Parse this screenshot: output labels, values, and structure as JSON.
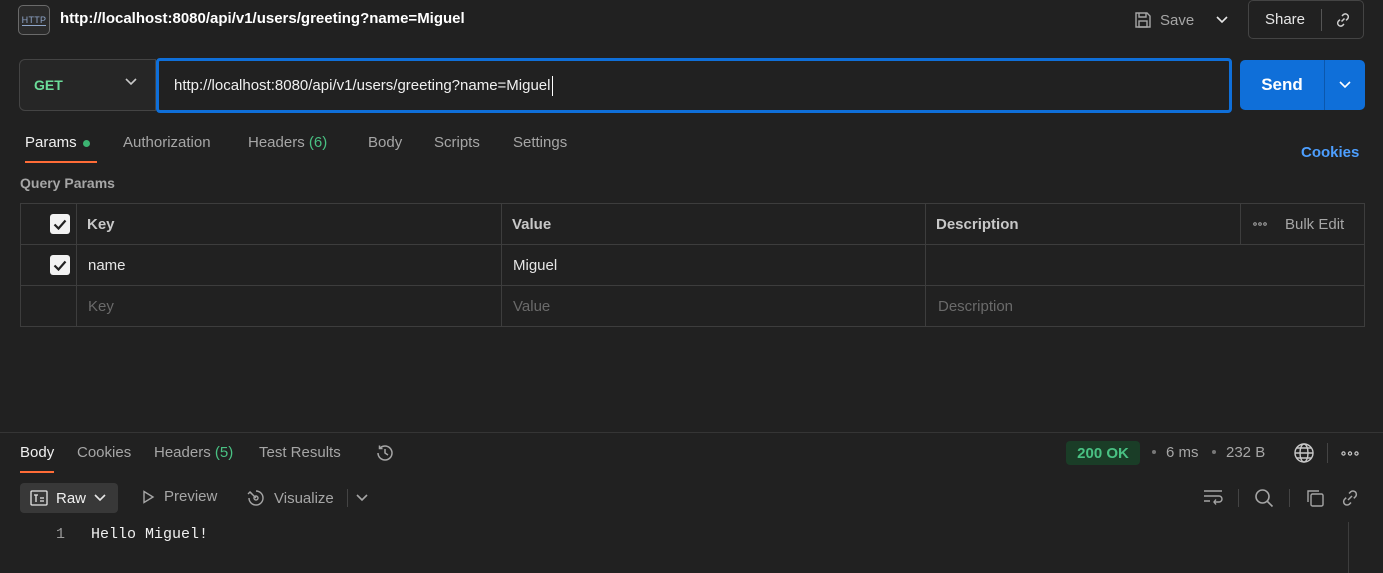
{
  "header": {
    "icon_label": "HTTP",
    "title": "http://localhost:8080/api/v1/users/greeting?name=Miguel",
    "save_label": "Save",
    "share_label": "Share"
  },
  "request": {
    "method": "GET",
    "url": "http://localhost:8080/api/v1/users/greeting?name=Miguel",
    "send_label": "Send"
  },
  "request_tabs": {
    "params": "Params",
    "authorization": "Authorization",
    "headers": "Headers",
    "headers_count": "(6)",
    "body": "Body",
    "scripts": "Scripts",
    "settings": "Settings",
    "cookies": "Cookies"
  },
  "query_params": {
    "label": "Query Params",
    "columns": [
      "Key",
      "Value",
      "Description"
    ],
    "bulk_edit": "Bulk Edit",
    "rows": [
      {
        "checked": true,
        "key": "name",
        "value": "Miguel",
        "description": ""
      }
    ],
    "placeholders": {
      "key": "Key",
      "value": "Value",
      "description": "Description"
    }
  },
  "response_tabs": {
    "body": "Body",
    "cookies": "Cookies",
    "headers": "Headers",
    "headers_count": "(5)",
    "test_results": "Test Results"
  },
  "response_meta": {
    "status": "200 OK",
    "time": "6 ms",
    "size": "232 B"
  },
  "response_toolbar": {
    "format": "Raw",
    "preview": "Preview",
    "visualize": "Visualize"
  },
  "response_body": {
    "line_number": "1",
    "content": "Hello Miguel!"
  },
  "colors": {
    "accent_blue": "#0f6fd9",
    "tab_underline": "#ff6c37",
    "status_green": "#49c183",
    "method_green": "#6bdd9a"
  }
}
